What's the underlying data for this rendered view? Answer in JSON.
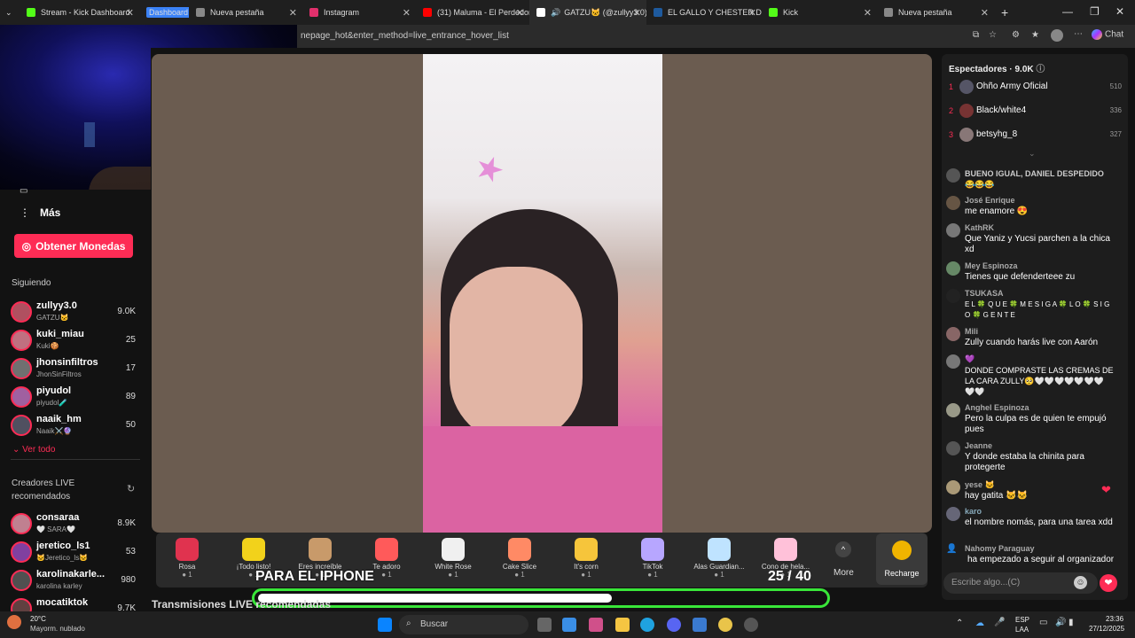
{
  "tabs": [
    {
      "label": "Stream - Kick Dashboard",
      "color": "#53fc18"
    },
    {
      "label": "Dashboard",
      "color": "#3b82f6"
    },
    {
      "label": "Nueva pestaña",
      "color": "#888888"
    },
    {
      "label": "Instagram",
      "color": "#e1306c"
    },
    {
      "label": "(31) Maluma - El Perdedor",
      "color": "#ff0000"
    },
    {
      "label": "GATZU🐱 (@zullyy3.0)",
      "color": "#ffffff"
    },
    {
      "label": "EL GALLO Y CHESTER DIBU",
      "color": "#1e5a9e"
    },
    {
      "label": "Kick",
      "color": "#53fc18"
    },
    {
      "label": "Nueva pestaña",
      "color": "#888888"
    }
  ],
  "address": "nepage_hot&enter_method=live_entrance_hover_list",
  "chat_button": "Chat",
  "sidebar": {
    "more": "Más",
    "coins_button": "Obtener Monedas",
    "following_title": "Siguiendo",
    "following": [
      {
        "name": "zullyy3.0",
        "sub": "GATZU🐱",
        "count": "9.0K"
      },
      {
        "name": "kuki_miau",
        "sub": "Kuki🍪",
        "count": "25"
      },
      {
        "name": "jhonsinfiltros",
        "sub": "JhonSinFiltros",
        "count": "17"
      },
      {
        "name": "piyudol",
        "sub": "piyudol🧪",
        "count": "89"
      },
      {
        "name": "naaik_hm",
        "sub": "Naaik⚔️🔮",
        "count": "50"
      }
    ],
    "see_all": "Ver todo",
    "recommended_title": "Creadores LIVE recomendados",
    "recommended": [
      {
        "name": "consaraa",
        "sub": "🤍 SARA🤍",
        "count": "8.9K"
      },
      {
        "name": "jeretico_ls1",
        "sub": "🐱Jeretico_ls🐱",
        "count": "53"
      },
      {
        "name": "karolinakarle...",
        "sub": "karolina karley",
        "count": "980"
      },
      {
        "name": "mocatiktok",
        "sub": "",
        "count": "9.7K"
      }
    ]
  },
  "gifts": [
    {
      "label": "Rosa",
      "cost": "1",
      "color": "#e0334f"
    },
    {
      "label": "¡Todo listo!",
      "cost": "1",
      "color": "#f2d21b"
    },
    {
      "label": "Eres increíble",
      "cost": "1",
      "color": "#c89a6a"
    },
    {
      "label": "Te adoro",
      "cost": "1",
      "color": "#ff5a5a"
    },
    {
      "label": "White Rose",
      "cost": "1",
      "color": "#f0f0f0"
    },
    {
      "label": "Cake Slice",
      "cost": "1",
      "color": "#ff8a65"
    },
    {
      "label": "It's corn",
      "cost": "1",
      "color": "#f6c53b"
    },
    {
      "label": "TikTok",
      "cost": "1",
      "color": "#b7a6ff"
    },
    {
      "label": "Alas Guardian...",
      "cost": "1",
      "color": "#bfe3ff"
    },
    {
      "label": "Cono de hela...",
      "cost": "1",
      "color": "#ffc1d9"
    }
  ],
  "more_label": "More",
  "recharge_label": "Recharge",
  "goal": {
    "text": "PARA EL IPHONE",
    "count": "25 / 40",
    "current": 25,
    "target": 40
  },
  "transmisiones": "Transmisiones LIVE recomendadas",
  "viewers": {
    "title": "Espectadores · 9.0K",
    "list": [
      {
        "rank": "1",
        "name": "Ohño Army Oficial",
        "count": "510"
      },
      {
        "rank": "2",
        "name": "Black/white4",
        "count": "336"
      },
      {
        "rank": "3",
        "name": "betsyhg_8",
        "count": "327"
      }
    ]
  },
  "chat": [
    {
      "name": "",
      "text": "BUENO IGUAL, DANIEL DESPEDIDO 😂😂😂"
    },
    {
      "name": "José Enrique",
      "text": "me enamore 😍"
    },
    {
      "name": "KathRK",
      "text": "Que Yaniz y Yucsi parchen a la chica xd"
    },
    {
      "name": "Mey Espinoza",
      "text": "Tienes que defenderteee zu"
    },
    {
      "name": "TSUKASA",
      "text": "E L 🍀 Q U E 🍀 M E S I G A 🍀 L O 🍀 S I G O 🍀 G E N T E"
    },
    {
      "name": "Mili",
      "text": "Zully cuando harás live con Aarón"
    },
    {
      "name": "💜",
      "text": "DONDE COMPRASTE LAS CREMAS DE LA CARA ZULLY🥺🤍🤍🤍🤍🤍🤍🤍🤍🤍"
    },
    {
      "name": "Anghel Espinoza",
      "text": "Pero la culpa es de quien te empujó pues"
    },
    {
      "name": "Jeanne",
      "text": "Y donde estaba la chinita para protegerte"
    },
    {
      "name": "yese 🐱",
      "text": "hay gatita 🐱🐱"
    },
    {
      "name": "karo",
      "text": "el nombre nomás, para una tarea xdd"
    },
    {
      "name": "Nahomy Paraguay",
      "text": "ha empezado a seguir al organizador"
    }
  ],
  "chat_placeholder": "Escribe algo...(C)",
  "taskbar": {
    "weather_temp": "20°C",
    "weather_desc": "Mayorm. nublado",
    "search": "Buscar",
    "lang": "ESP",
    "lang2": "LAA",
    "time": "23:36",
    "date": "27/12/2025"
  }
}
